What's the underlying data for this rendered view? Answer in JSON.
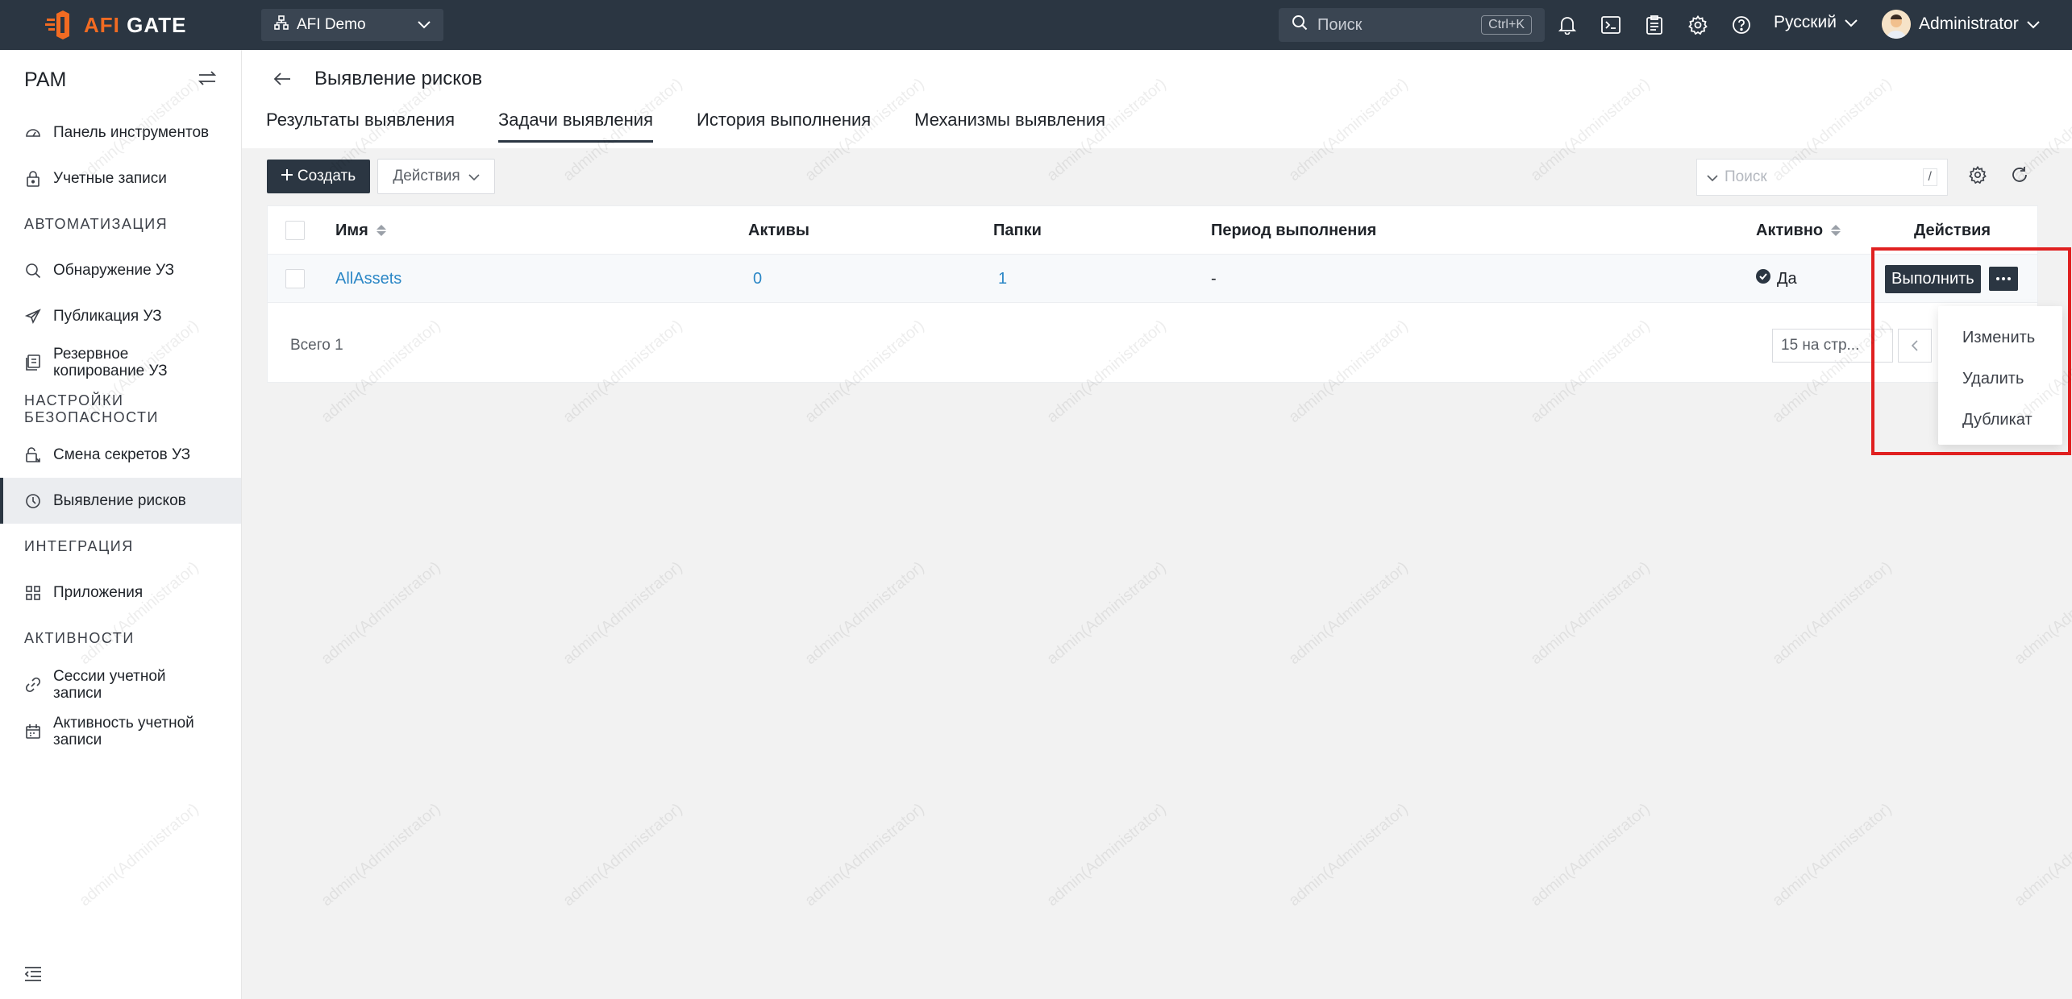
{
  "app": {
    "logo_prefix": "AFI",
    "logo_suffix": "GATE",
    "org": "AFI Demo",
    "search_placeholder": "Поиск",
    "search_shortcut": "Ctrl+K",
    "language": "Русский",
    "user": "Administrator",
    "colors": {
      "topbar": "#2b3642",
      "accent": "#f26b22",
      "link": "#2b87c6",
      "highlight": "#e02020"
    }
  },
  "sidebar": {
    "title": "PAM",
    "items": [
      {
        "label": "Панель инструментов",
        "icon": "dashboard-icon"
      },
      {
        "label": "Учетные записи",
        "icon": "lock-icon"
      }
    ],
    "section_automation": "АВТОМАТИЗАЦИЯ",
    "automation_items": [
      {
        "label": "Обнаружение УЗ",
        "icon": "search-icon"
      },
      {
        "label": "Публикация УЗ",
        "icon": "send-icon"
      },
      {
        "label_line1": "Резервное",
        "label_line2": "копирование УЗ",
        "icon": "backup-icon"
      }
    ],
    "section_security": "НАСТРОЙКИ БЕЗОПАСНОСТИ",
    "security_items": [
      {
        "label": "Смена секретов УЗ",
        "icon": "secret-change-icon"
      },
      {
        "label": "Выявление рисков",
        "icon": "risk-icon",
        "active": true
      }
    ],
    "section_integration": "ИНТЕГРАЦИЯ",
    "integration_items": [
      {
        "label": "Приложения",
        "icon": "apps-icon"
      }
    ],
    "section_activity": "АКТИВНОСТИ",
    "activity_items": [
      {
        "label_line1": "Сессии учетной",
        "label_line2": "записи",
        "icon": "link-icon"
      },
      {
        "label_line1": "Активность учетной",
        "label_line2": "записи",
        "icon": "calendar-icon"
      }
    ]
  },
  "page": {
    "title": "Выявление рисков",
    "tabs": [
      "Результаты выявления",
      "Задачи выявления",
      "История выполнения",
      "Механизмы выявления"
    ],
    "active_tab": 1
  },
  "toolbar": {
    "create": "Создать",
    "actions": "Действия",
    "search_placeholder": "Поиск",
    "search_shortcut": "/"
  },
  "table": {
    "columns": [
      "Имя",
      "Активы",
      "Папки",
      "Период выполнения",
      "Активно",
      "Действия"
    ],
    "rows": [
      {
        "name": "AllAssets",
        "assets": "0",
        "folders": "1",
        "period": "-",
        "active": "Да",
        "run": "Выполнить"
      }
    ],
    "total": "Всего 1",
    "page_size": "15 на стр..."
  },
  "dropdown": {
    "items": [
      "Изменить",
      "Удалить",
      "Дубликат"
    ]
  },
  "watermark": "admin(Administrator)"
}
